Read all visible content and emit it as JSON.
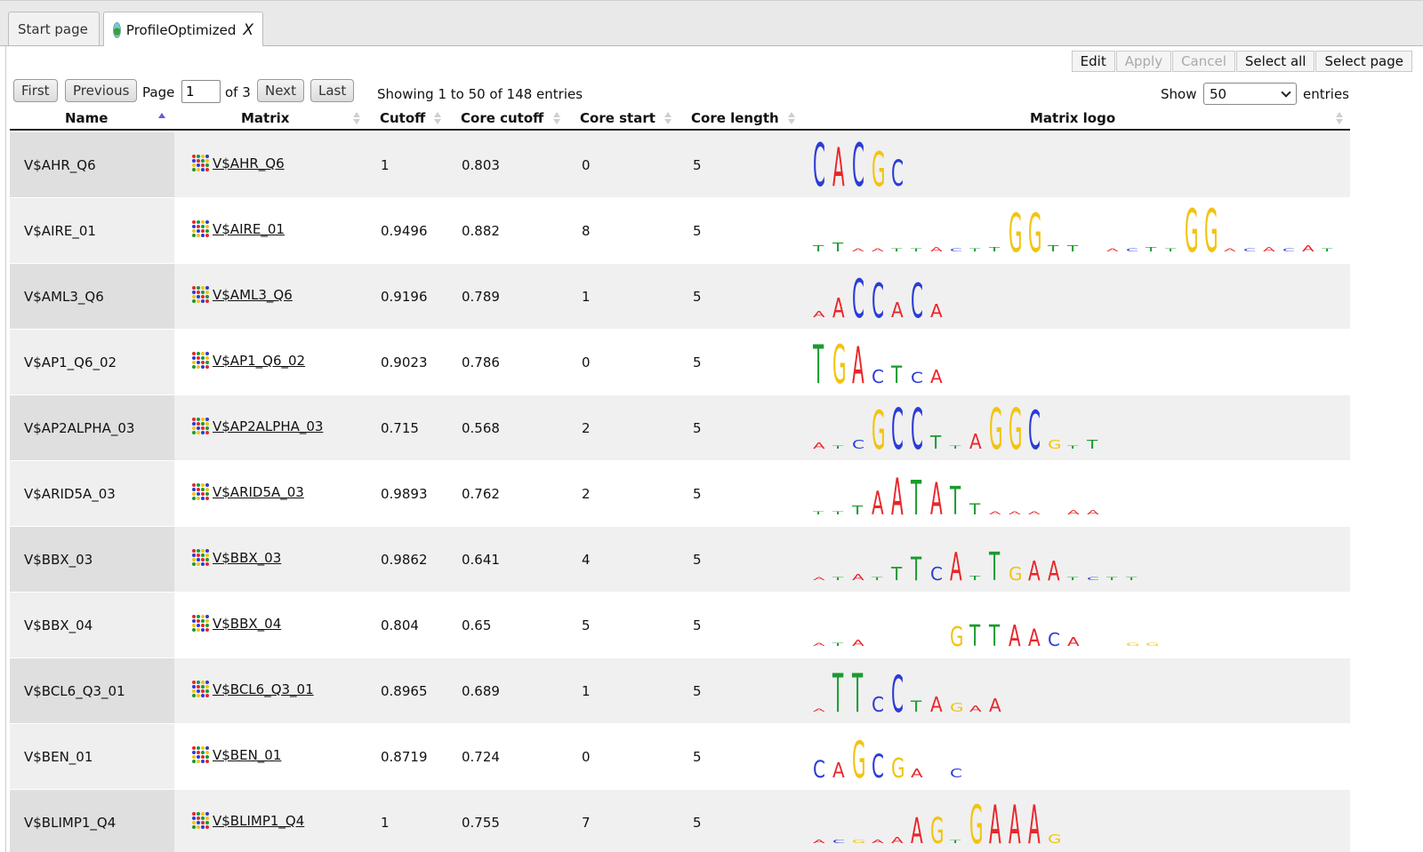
{
  "tabs": [
    {
      "label": "Start page"
    },
    {
      "label": "ProfileOptimized",
      "close": "X"
    }
  ],
  "toolbar": {
    "edit": "Edit",
    "apply": "Apply",
    "cancel": "Cancel",
    "select_all": "Select all",
    "select_page": "Select page"
  },
  "pager": {
    "first": "First",
    "previous": "Previous",
    "page_label": "Page",
    "page_value": "1",
    "of_label": "of 3",
    "next": "Next",
    "last": "Last",
    "info": "Showing 1 to 50 of 148 entries",
    "show_label": "Show",
    "show_value": "50",
    "entries_label": "entries"
  },
  "columns": {
    "name": "Name",
    "matrix": "Matrix",
    "cutoff": "Cutoff",
    "core_cutoff": "Core cutoff",
    "core_start": "Core start",
    "core_length": "Core length",
    "matrix_logo": "Matrix logo"
  },
  "colors": {
    "A": "#e8262b",
    "C": "#2b3cd6",
    "G": "#f2c40f",
    "T": "#1a9a2f"
  },
  "rows": [
    {
      "name": "V$AHR_Q6",
      "matrix": "V$AHR_Q6",
      "cutoff": "1",
      "core_cutoff": "0.803",
      "core_start": "0",
      "core_length": "5",
      "logo": [
        "C:1",
        "A:0.9",
        "C:1",
        "G:0.8",
        "C:0.6"
      ]
    },
    {
      "name": "V$AIRE_01",
      "matrix": "V$AIRE_01",
      "cutoff": "0.9496",
      "core_cutoff": "0.882",
      "core_start": "8",
      "core_length": "5",
      "logo": [
        "T:0.15",
        "T:0.2",
        "A:0.05",
        "A:0.05",
        "T:0.05",
        "T:0.05",
        "A:0.1",
        "C:0.05",
        "T:0.05",
        "T:0.1",
        "G:0.9",
        "G:0.9",
        "T:0.15",
        "T:0.15",
        "-:0",
        "A:0.05",
        "C:0.05",
        "T:0.1",
        "T:0.05",
        "G:1",
        "G:1",
        "A:0.05",
        "C:0.05",
        "A:0.1",
        "C:0.05",
        "A:0.15",
        "T:0.05"
      ]
    },
    {
      "name": "V$AML3_Q6",
      "matrix": "V$AML3_Q6",
      "cutoff": "0.9196",
      "core_cutoff": "0.789",
      "core_start": "1",
      "core_length": "5",
      "logo": [
        "A:0.15",
        "A:0.45",
        "C:0.9",
        "C:0.8",
        "A:0.35",
        "C:0.8",
        "A:0.3"
      ]
    },
    {
      "name": "V$AP1_Q6_02",
      "matrix": "V$AP1_Q6_02",
      "cutoff": "0.9023",
      "core_cutoff": "0.786",
      "core_start": "0",
      "core_length": "5",
      "logo": [
        "T:0.9",
        "G:0.9",
        "A:0.85",
        "C:0.3",
        "T:0.4",
        "C:0.25",
        "A:0.3"
      ]
    },
    {
      "name": "V$AP2ALPHA_03",
      "matrix": "V$AP2ALPHA_03",
      "cutoff": "0.715",
      "core_cutoff": "0.568",
      "core_start": "2",
      "core_length": "5",
      "logo": [
        "A:0.15",
        "T:0.05",
        "C:0.2",
        "G:0.9",
        "C:0.95",
        "C:0.95",
        "T:0.3",
        "T:0.05",
        "A:0.35",
        "G:0.95",
        "G:0.95",
        "C:0.9",
        "G:0.2",
        "T:0.05",
        "T:0.2"
      ]
    },
    {
      "name": "V$ARID5A_03",
      "matrix": "V$ARID5A_03",
      "cutoff": "0.9893",
      "core_cutoff": "0.762",
      "core_start": "2",
      "core_length": "5",
      "logo": [
        "T:0.05",
        "T:0.05",
        "T:0.2",
        "A:0.55",
        "A:0.85",
        "T:0.8",
        "A:0.75",
        "T:0.65",
        "T:0.25",
        "A:0.05",
        "A:0.05",
        "A:0.05",
        "-:0",
        "A:0.1",
        "A:0.1"
      ]
    },
    {
      "name": "V$BBX_03",
      "matrix": "V$BBX_03",
      "cutoff": "0.9862",
      "core_cutoff": "0.641",
      "core_start": "4",
      "core_length": "5",
      "logo": [
        "A:0.05",
        "T:0.05",
        "A:0.15",
        "T:0.05",
        "T:0.3",
        "T:0.55",
        "C:0.3",
        "A:0.65",
        "T:0.1",
        "T:0.65",
        "G:0.3",
        "A:0.45",
        "A:0.45",
        "T:0.05",
        "C:0.05",
        "T:0.05",
        "T:0.05"
      ]
    },
    {
      "name": "V$BBX_04",
      "matrix": "V$BBX_04",
      "cutoff": "0.804",
      "core_cutoff": "0.65",
      "core_start": "5",
      "core_length": "5",
      "logo": [
        "A:0.03",
        "T:0.03",
        "A:0.15",
        "-:0",
        "-:0",
        "-:0",
        "-:0",
        "G:0.45",
        "T:0.5",
        "T:0.5",
        "A:0.5",
        "A:0.4",
        "C:0.3",
        "A:0.2",
        "-:0",
        "-:0",
        "G:0.03",
        "G:0.03",
        "-:0"
      ]
    },
    {
      "name": "V$BCL6_Q3_01",
      "matrix": "V$BCL6_Q3_01",
      "cutoff": "0.8965",
      "core_cutoff": "0.689",
      "core_start": "1",
      "core_length": "5",
      "logo": [
        "A:0.05",
        "T:0.9",
        "T:0.9",
        "C:0.35",
        "C:0.85",
        "T:0.25",
        "A:0.35",
        "G:0.2",
        "A:0.15",
        "A:0.3"
      ]
    },
    {
      "name": "V$BEN_01",
      "matrix": "V$BEN_01",
      "cutoff": "0.8719",
      "core_cutoff": "0.724",
      "core_start": "0",
      "core_length": "5",
      "logo": [
        "C:0.4",
        "A:0.35",
        "G:0.85",
        "C:0.55",
        "G:0.45",
        "A:0.2",
        "-:0",
        "C:0.2"
      ]
    },
    {
      "name": "V$BLIMP1_Q4",
      "matrix": "V$BLIMP1_Q4",
      "cutoff": "1",
      "core_cutoff": "0.755",
      "core_start": "7",
      "core_length": "5",
      "logo": [
        "A:0.08",
        "C:0.08",
        "G:0.08",
        "A:0.08",
        "A:0.15",
        "A:0.6",
        "G:0.6",
        "T:0.05",
        "G:0.9",
        "A:0.9",
        "A:0.9",
        "A:0.9",
        "G:0.2"
      ]
    }
  ]
}
